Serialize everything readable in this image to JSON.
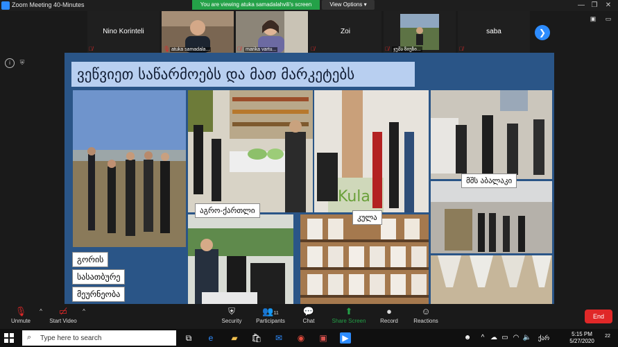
{
  "window": {
    "title": "Zoom Meeting 40-Minutes",
    "share_banner": "You are viewing atuka samadalahvili's screen",
    "view_options": "View Options"
  },
  "participants": [
    {
      "name": "Nino Korinteli",
      "type": "name"
    },
    {
      "name": "atuka samadala...",
      "type": "video"
    },
    {
      "name": "marika vartu...",
      "type": "video"
    },
    {
      "name": "Zoi",
      "type": "name"
    },
    {
      "name": "ჯუმა ზიუზი...",
      "type": "video"
    },
    {
      "name": "saba",
      "type": "name"
    }
  ],
  "slide": {
    "title": "ვეწვიეთ საწარმოებს და მათ მარკეტებს",
    "labels": {
      "msh": "მშს აბალაკი",
      "agro": "აგრო-ქართლი",
      "kula": "კულა",
      "gori1": "გორის",
      "gori2": "სასათბურე",
      "gori3": "მეურნეობა"
    }
  },
  "toolbar": {
    "unmute": "Unmute",
    "start_video": "Start Video",
    "security": "Security",
    "participants": "Participants",
    "participants_count": "11",
    "chat": "Chat",
    "share_screen": "Share Screen",
    "record": "Record",
    "reactions": "Reactions",
    "end": "End"
  },
  "taskbar": {
    "search_placeholder": "Type here to search",
    "time": "5:15 PM",
    "date": "5/27/2020",
    "notifications": "22",
    "language": "ქარ"
  },
  "colors": {
    "zoom_blue": "#2d8cff",
    "share_green": "#24a148",
    "end_red": "#e02828",
    "slide_blue": "#2a5587"
  }
}
